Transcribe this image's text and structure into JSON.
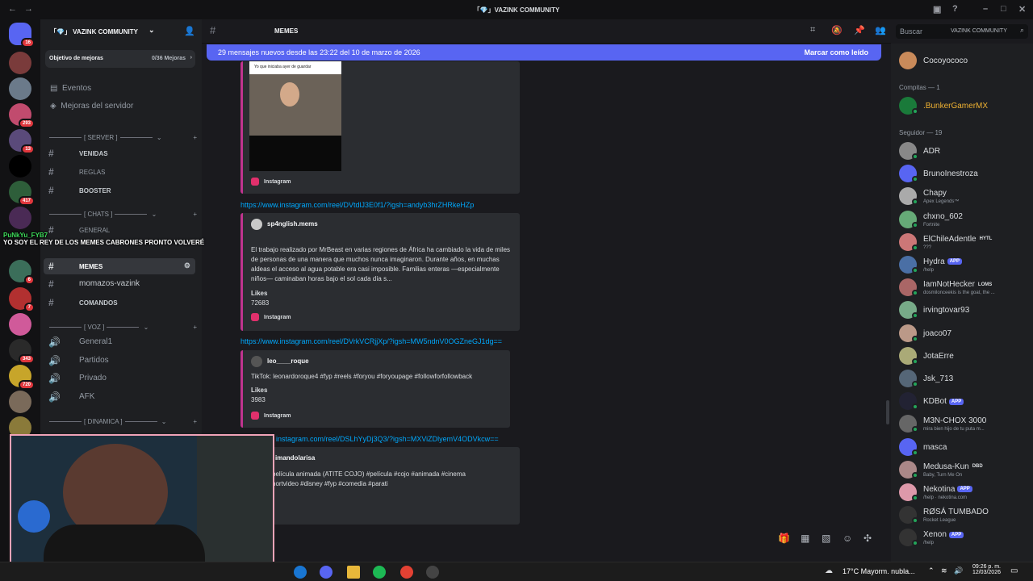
{
  "window": {
    "title": "「💎」VAZINK COMMUNITY"
  },
  "server": {
    "name": "「💎」 VAZINK COMMUNITY",
    "boost": {
      "label": "Objetivo de mejoras",
      "progress": "0/36 Mejoras"
    },
    "nav": [
      {
        "label": "Eventos"
      },
      {
        "label": "Mejoras del servidor"
      }
    ],
    "rail_badges": [
      "16",
      "293",
      "13",
      "417",
      "6",
      "7",
      "343",
      "720"
    ]
  },
  "categories": {
    "server": "[ SERVER ]",
    "chats": "[ CHATS ]",
    "voz": "[ VOZ ]",
    "dinamica": "[ DINAMICA ]"
  },
  "channels": {
    "venidas": "VENIDAS",
    "reglas": "REGLAS",
    "booster": "BOOSTER",
    "general": "GENERAL",
    "memes": "MEMES",
    "momazos": "momazos-vazink",
    "comandos": "COMANDOS"
  },
  "voice": [
    "General1",
    "Partidos",
    "Privado",
    "AFK"
  ],
  "header": {
    "channel": "MEMES",
    "search_placeholder": "Buscar",
    "search_scope": "VAZINK COMMUNITY"
  },
  "banner": {
    "text": "29 mensajes nuevos desde las 23:22 del 10 de marzo de 2026",
    "action": "Marcar como leído"
  },
  "messages": [
    {
      "image_caption": "Yo que iniciaba ayer de guardar",
      "source": "Instagram"
    },
    {
      "link": "https://www.instagram.com/reel/DVtdlJ3E0f1/?igsh=andyb3hrZHRkeHZp",
      "author": "sp4nglish.mems",
      "text": "El trabajo realizado por MrBeast en varias regiones de África ha cambiado la vida de miles de personas de una manera que muchos nunca imaginaron. Durante años, en muchas aldeas el acceso al agua potable era casi imposible. Familias enteras —especialmente niños— caminaban horas bajo el sol cada día s...",
      "likes_label": "Likes",
      "likes": "72683",
      "source": "Instagram"
    },
    {
      "link": "https://www.instagram.com/reel/DVrkVCRjjXp/?igsh=MW5ndnV0OGZneGJ1dg==",
      "author": "leo____roque",
      "text": "TikTok: leonardoroque4 #fyp #reels #foryou #foryoupage #followforfollowback",
      "likes_label": "Likes",
      "likes": "3983",
      "source": "Instagram"
    },
    {
      "link": "instagram.com/reel/DSLhYyDj3Q3/?igsh=MXViZDlyemV4ODVkcw==",
      "author": "imandolarisa",
      "text": "película animada (ATITE COJO) #película #cojo #animada #cinema hortvideo #disney #fyp #comedia #parati"
    }
  ],
  "members": {
    "groups": [
      {
        "label": "Compitas — 1"
      },
      {
        "label": "Seguidor — 19"
      }
    ],
    "top": {
      "name": "Cocoyococo"
    },
    "compitas": {
      "name": ".BunkerGamerMX"
    },
    "list": [
      {
        "name": "ADR",
        "sub": ""
      },
      {
        "name": "BrunoInestroza",
        "sub": ""
      },
      {
        "name": "Chapy",
        "sub": "Apex Legends™"
      },
      {
        "name": "chxno_602",
        "sub": "Fortnite"
      },
      {
        "name": "ElChileAdentle",
        "sub": "???",
        "tag": "HYTL"
      },
      {
        "name": "Hydra",
        "sub": "/help",
        "tag": "APP"
      },
      {
        "name": "IamNotHecker",
        "sub": "dosmilonceekis is the goat, the ...",
        "tag": "LOMS"
      },
      {
        "name": "irvingtovar93",
        "sub": ""
      },
      {
        "name": "joaco07",
        "sub": ""
      },
      {
        "name": "JotaErre",
        "sub": ""
      },
      {
        "name": "Jsk_713",
        "sub": ""
      },
      {
        "name": "KDBot",
        "sub": "",
        "tag": "APP"
      },
      {
        "name": "M3N-CHOX 3000",
        "sub": "mira bien hijo de tu puta m...",
        "tag": ""
      },
      {
        "name": "masca",
        "sub": ""
      },
      {
        "name": "Medusa-Kun",
        "sub": "Baby, Turn Me On",
        "tag": "DBD"
      },
      {
        "name": "Nekotina",
        "sub": "/help · nekotina.com",
        "tag": "APP"
      },
      {
        "name": "RØSÁ TUMBADO",
        "sub": "Rocket League"
      },
      {
        "name": "Xenon",
        "sub": "/help",
        "tag": "APP"
      }
    ]
  },
  "overlay": {
    "user": "PuNkYu_FYB7",
    "text": "YO SOY EL REY DE LOS MEMES CABRONES PRONTO VOLVERÉ"
  },
  "taskbar": {
    "weather": "17°C  Mayorm. nubla...",
    "time": "09:26 p. m.",
    "date": "12/03/2026"
  }
}
